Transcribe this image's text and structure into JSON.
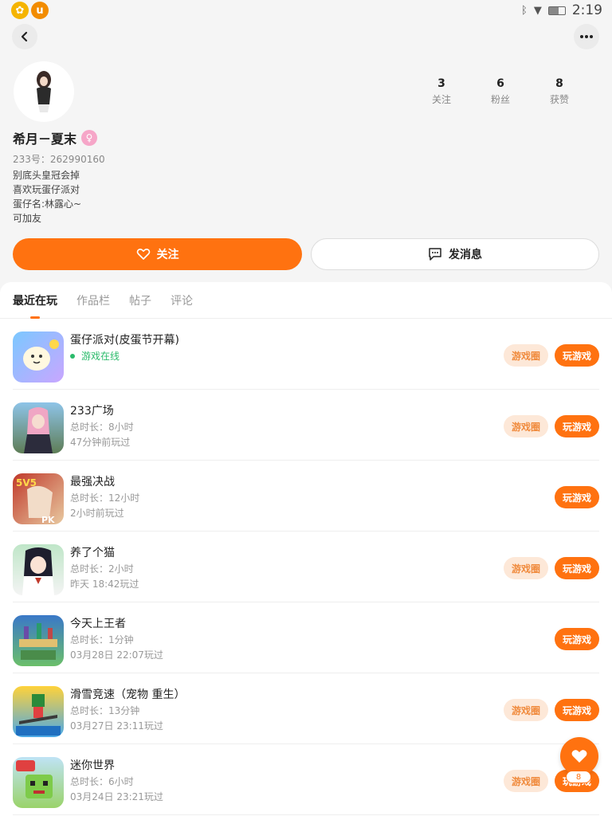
{
  "status_bar": {
    "time": "2:19",
    "battery_level": 0.6
  },
  "profile": {
    "username": "希月－夏末",
    "gender_icon": "female-icon",
    "uid": "233号：262990160",
    "bio": [
      "别底头皇冠会掉",
      "喜欢玩蛋仔派对",
      "蛋仔名:林露心~",
      "可加友"
    ],
    "stats": [
      {
        "num": "3",
        "label": "关注"
      },
      {
        "num": "6",
        "label": "粉丝"
      },
      {
        "num": "8",
        "label": "获赞"
      }
    ]
  },
  "actions": {
    "follow_label": "关注",
    "message_label": "发消息"
  },
  "tabs": [
    {
      "label": "最近在玩",
      "active": true
    },
    {
      "label": "作品栏",
      "active": false
    },
    {
      "label": "帖子",
      "active": false
    },
    {
      "label": "评论",
      "active": false
    }
  ],
  "games": [
    {
      "name": "蛋仔派对(皮蛋节开幕)",
      "line2": "游戏在线",
      "line3": "",
      "online": true,
      "has_circle": true,
      "icon": "egg-party-icon"
    },
    {
      "name": "233广场",
      "line2": "总时长：8小时",
      "line3": "47分钟前玩过",
      "online": false,
      "has_circle": true,
      "icon": "plaza-icon"
    },
    {
      "name": "最强决战",
      "line2": "总时长：12小时",
      "line3": "2小时前玩过",
      "online": false,
      "has_circle": false,
      "icon": "battle-icon"
    },
    {
      "name": "养了个猫",
      "line2": "总时长：2小时",
      "line3": "昨天 18:42玩过",
      "online": false,
      "has_circle": true,
      "icon": "cat-icon"
    },
    {
      "name": "今天上王者",
      "line2": "总时长：1分钟",
      "line3": "03月28日 22:07玩过",
      "online": false,
      "has_circle": false,
      "icon": "king-icon"
    },
    {
      "name": "滑雪竞速（宠物 重生）",
      "line2": "总时长：13分钟",
      "line3": "03月27日 23:11玩过",
      "online": false,
      "has_circle": true,
      "icon": "ski-icon"
    },
    {
      "name": "迷你世界",
      "line2": "总时长：6小时",
      "line3": "03月24日 23:21玩过",
      "online": false,
      "has_circle": true,
      "icon": "mini-world-icon"
    }
  ],
  "buttons": {
    "circle_label": "游戏圈",
    "play_label": "玩游戏"
  },
  "like_fab": {
    "count": "8"
  },
  "colors": {
    "accent": "#ff7210",
    "online": "#2bbb6b"
  }
}
